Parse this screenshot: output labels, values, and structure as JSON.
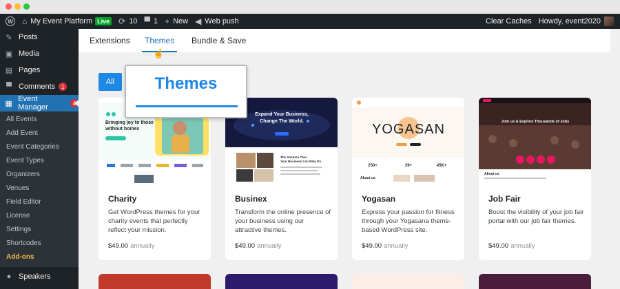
{
  "adminbar": {
    "site_name": "My Event Platform",
    "live_badge": "Live",
    "updates_count": "10",
    "comments_count": "1",
    "new_label": "New",
    "web_push_label": "Web push",
    "clear_caches_label": "Clear Caches",
    "howdy_label": "Howdy, event2020"
  },
  "sidebar": {
    "items": [
      {
        "label": "Posts",
        "icon": "pin-icon"
      },
      {
        "label": "Media",
        "icon": "media-icon"
      },
      {
        "label": "Pages",
        "icon": "pages-icon"
      },
      {
        "label": "Comments",
        "icon": "comment-icon",
        "badge": "1"
      },
      {
        "label": "Event Manager",
        "icon": "calendar-icon",
        "badge": "4"
      }
    ],
    "submenu": [
      "All Events",
      "Add Event",
      "Event Categories",
      "Event Types",
      "Organizers",
      "Venues",
      "Field Editor",
      "License",
      "Settings",
      "Shortcodes",
      "Add-ons"
    ],
    "bottom_item": {
      "label": "Speakers",
      "icon": "speaker-icon"
    }
  },
  "tabs": [
    "Extensions",
    "Themes",
    "Bundle & Save"
  ],
  "filter": {
    "all_label": "All"
  },
  "zoom": {
    "label": "Themes"
  },
  "cards": [
    {
      "name": "Charity",
      "desc": "Get WordPress themes for your charity events that perfectly reflect your mission.",
      "price": "$49.00",
      "per": "annually",
      "thumb": {
        "headline": "Bringing joy to those without homes",
        "accent": "#2ec4a6"
      }
    },
    {
      "name": "Businex",
      "desc": "Transform the online presence of your business using our attractive themes.",
      "price": "$49.00",
      "per": "annually",
      "thumb": {
        "headline": "Expand Your Business, Change The World.",
        "sub": "The Solution That Your Business Can Rely On",
        "accent": "#1a2a6c"
      }
    },
    {
      "name": "Yogasan",
      "desc": "Express your passion for fitness through your Yogasana theme-based WordPress site.",
      "price": "$49.00",
      "per": "annually",
      "thumb": {
        "brand": "YOGASAN",
        "stats": [
          "250+",
          "39+",
          "45K+"
        ],
        "section": "About us",
        "accent": "#f39c4a"
      }
    },
    {
      "name": "Job Fair",
      "desc": "Boost the visibility of your job fair portal with our job fair themes.",
      "price": "$49.00",
      "per": "annually",
      "thumb": {
        "headline": "Join us & Explore Thousands of Jobs",
        "section": "About us",
        "countdown": [
          "1",
          "2",
          "3",
          "4"
        ],
        "accent": "#e6175c"
      }
    }
  ],
  "colors": {
    "admin_dark": "#1d2327",
    "wp_blue": "#2271b1",
    "accent_blue": "#1e88e5",
    "addons_highlight": "#f0b849",
    "badge_red": "#d63638",
    "live_green": "#00a32a"
  }
}
